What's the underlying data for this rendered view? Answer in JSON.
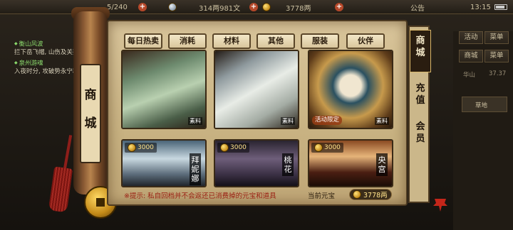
{
  "topbar": {
    "gold_partial": "5/240",
    "silver": "314两981文",
    "yuanbao": "3778两",
    "announce": "公告",
    "time": "13:15"
  },
  "quest": {
    "items": [
      {
        "title": "衡山风波",
        "desc": "拦下岳飞帽, 山伤及关要"
      },
      {
        "title": "泉州游魂",
        "desc": "入夜时分, 攻破势永宁郡"
      }
    ]
  },
  "right_side": {
    "buttons": [
      "活动",
      "菜单",
      "商城",
      "菜单"
    ],
    "location": "华山",
    "coords": "37.37",
    "map_label": "草地"
  },
  "roller_title": [
    "商",
    "城"
  ],
  "tabs": [
    "每日热卖",
    "消耗",
    "材料",
    "其他",
    "服装",
    "伙伴"
  ],
  "side_tabs": [
    {
      "label": [
        "商",
        "城"
      ],
      "active": true
    },
    {
      "label": [
        "充",
        "值"
      ],
      "active": false
    },
    {
      "label": [
        "会",
        "员"
      ],
      "active": false
    }
  ],
  "cards_row1": [
    {
      "tag": "素料",
      "limited": ""
    },
    {
      "tag": "素料",
      "limited": ""
    },
    {
      "tag": "素料",
      "limited": "活动限定"
    }
  ],
  "cards_row2": [
    {
      "price": "3000",
      "name": "拜妮娜"
    },
    {
      "price": "3000",
      "name": "桃花"
    },
    {
      "price": "3000",
      "name": "央宫"
    }
  ],
  "bottom": {
    "tip": "※提示: 私自回档并不会返还已消费掉的元宝和道具",
    "current_label": "当前元宝",
    "current_value": "3778两"
  },
  "colors": {
    "parchment": "#d9c59b",
    "frame": "#4e3b22",
    "accent_red": "#9a1e12",
    "gold": "#ffe38a"
  }
}
